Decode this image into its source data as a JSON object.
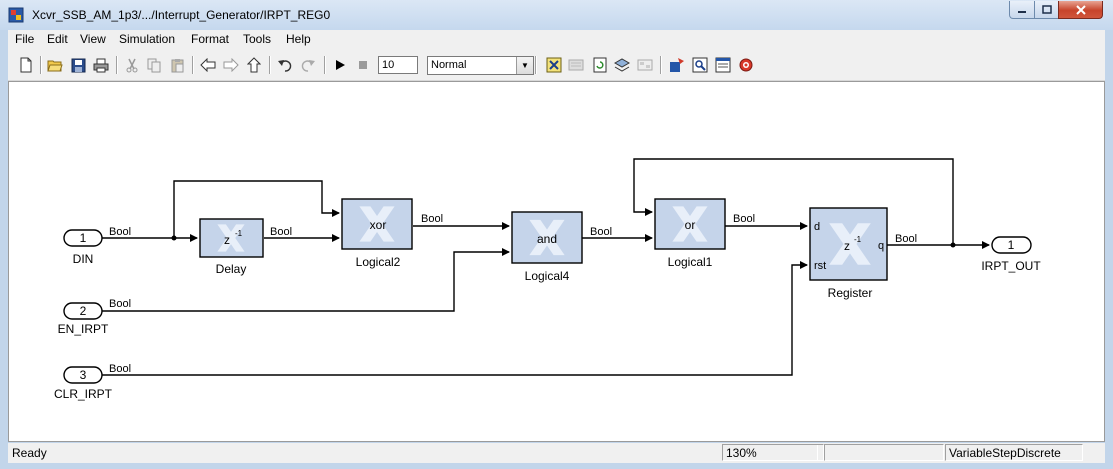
{
  "window": {
    "title": "Xcvr_SSB_AM_1p3/.../Interrupt_Generator/IRPT_REG0"
  },
  "menu": [
    "File",
    "Edit",
    "View",
    "Simulation",
    "Format",
    "Tools",
    "Help"
  ],
  "toolbar": {
    "stop_time": "10",
    "sim_mode": "Normal",
    "icons": [
      "new-icon",
      "open-icon",
      "save-icon",
      "print-icon",
      "cut-icon",
      "copy-icon",
      "paste-icon",
      "back-icon",
      "forward-icon",
      "up-icon",
      "undo-icon",
      "redo-icon",
      "run-icon",
      "stop-icon",
      "build-icon",
      "library-icon",
      "update-icon",
      "model-explorer-icon",
      "block-library-icon",
      "debug-icon",
      "zoom-icon",
      "explorer-icon",
      "target-icon"
    ]
  },
  "diagram": {
    "inports": [
      {
        "num": "1",
        "name": "DIN"
      },
      {
        "num": "2",
        "name": "EN_IRPT"
      },
      {
        "num": "3",
        "name": "CLR_IRPT"
      }
    ],
    "outport": {
      "num": "1",
      "name": "IRPT_OUT"
    },
    "blocks": {
      "delay": {
        "name": "Delay",
        "label": "z",
        "exp": "-1"
      },
      "logical2": {
        "name": "Logical2",
        "op": "xor"
      },
      "logical4": {
        "name": "Logical4",
        "op": "and"
      },
      "logical1": {
        "name": "Logical1",
        "op": "or"
      },
      "register": {
        "name": "Register",
        "label": "z",
        "exp": "-1",
        "port_d": "d",
        "port_rst": "rst",
        "port_q": "q"
      }
    },
    "signal_type": "Bool"
  },
  "status": {
    "state": "Ready",
    "zoom": "130%",
    "solver": "VariableStepDiscrete"
  },
  "colors": {
    "block_fill": "#c5d4ea",
    "block_border": "#000000",
    "logo": "#e6eefa"
  }
}
